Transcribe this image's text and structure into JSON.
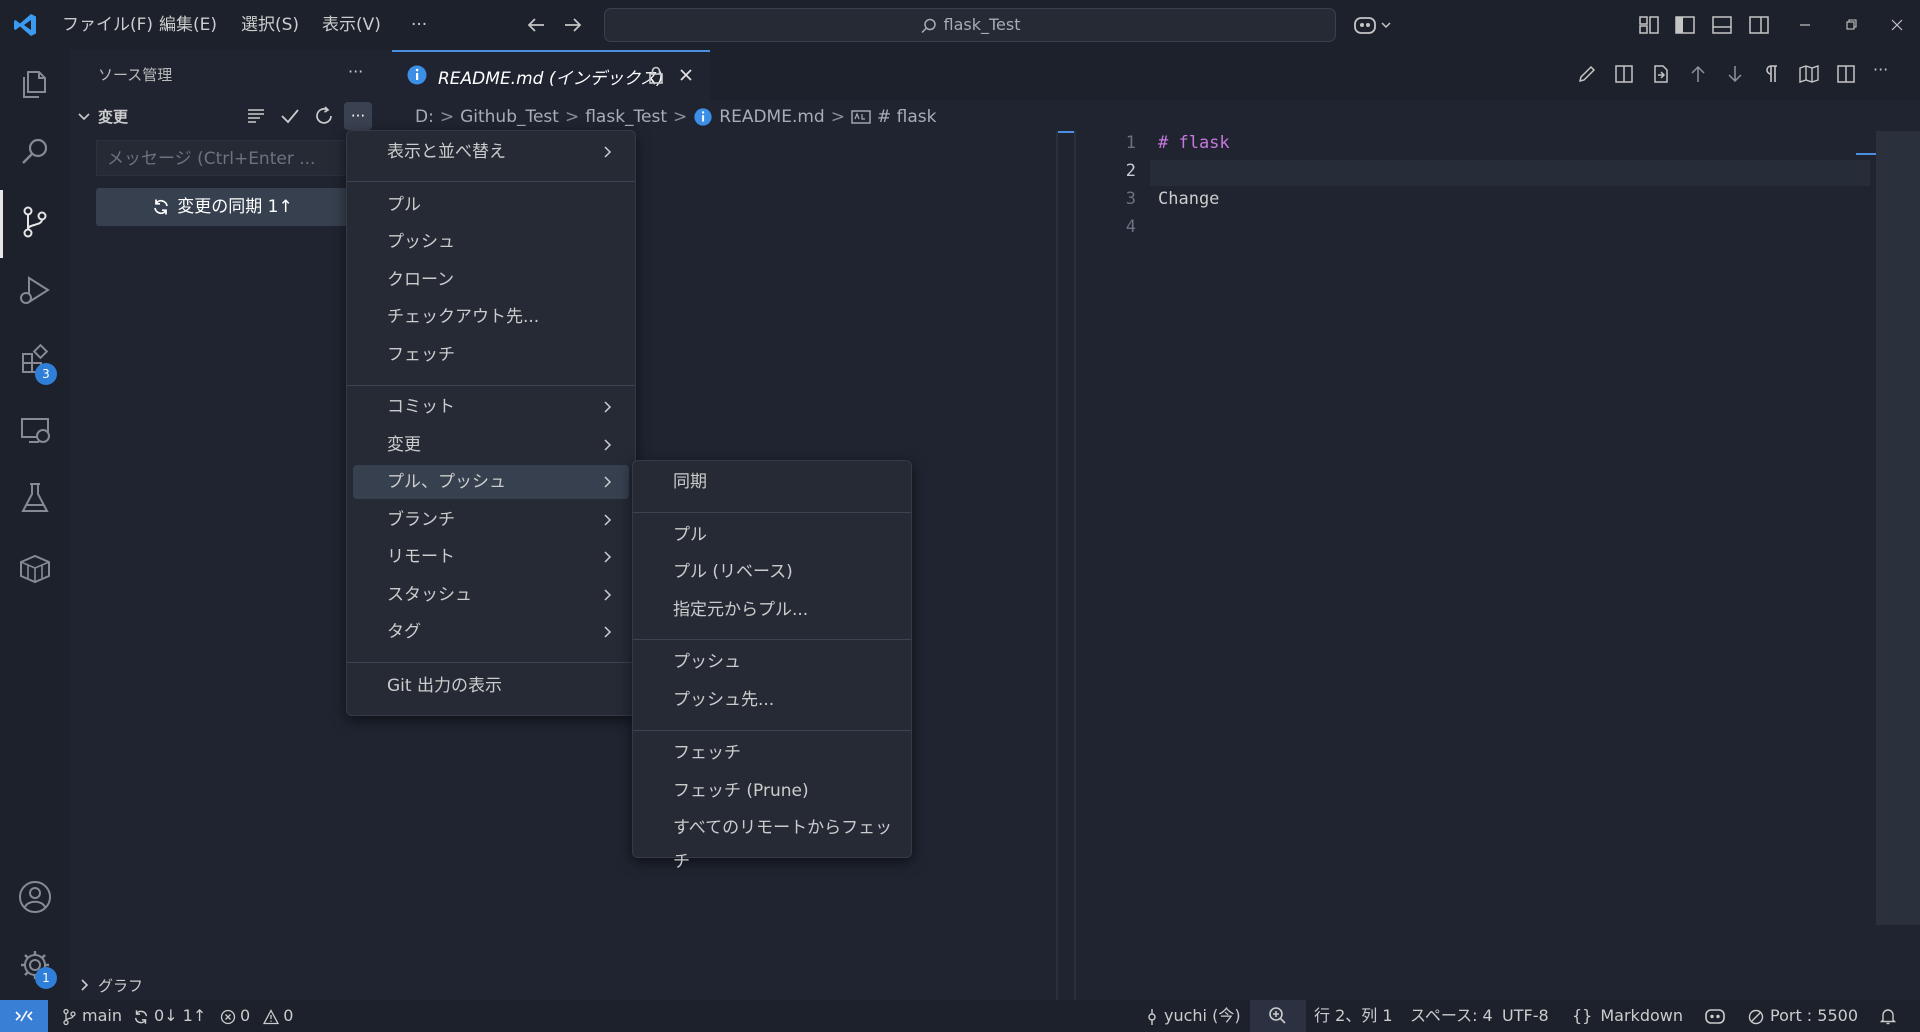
{
  "titlebar": {
    "menus": [
      "ファイル(F)",
      "編集(E)",
      "選択(S)",
      "表示(V)",
      "···"
    ],
    "search_text": "flask_Test"
  },
  "activity": {
    "extensions_badge": "3",
    "settings_badge": "1"
  },
  "sidebar": {
    "title": "ソース管理",
    "more": "···",
    "changes_header": "変更",
    "commit_placeholder": "メッセージ (Ctrl+Enter ...",
    "sync_button": "変更の同期 1↑",
    "graph_header": "グラフ"
  },
  "editor": {
    "tab_label": "README.md (インデックス)",
    "breadcrumb": [
      "D:",
      "Github_Test",
      "flask_Test",
      "README.md",
      "# flask"
    ],
    "lines": [
      {
        "no": "1",
        "text": "# flask"
      },
      {
        "no": "2",
        "text": ""
      },
      {
        "no": "3",
        "text": "Change"
      },
      {
        "no": "4",
        "text": ""
      }
    ]
  },
  "menu": {
    "items": [
      "表示と並べ替え",
      "プル",
      "プッシュ",
      "クローン",
      "チェックアウト先...",
      "フェッチ",
      "コミット",
      "変更",
      "プル、プッシュ",
      "ブランチ",
      "リモート",
      "スタッシュ",
      "タグ",
      "Git 出力の表示"
    ]
  },
  "submenu": {
    "items": [
      "同期",
      "プル",
      "プル (リベース)",
      "指定元からプル...",
      "プッシュ",
      "プッシュ先...",
      "フェッチ",
      "フェッチ (Prune)",
      "すべてのリモートからフェッチ"
    ]
  },
  "statusbar": {
    "branch": "main",
    "sync": "0↓ 1↑",
    "errors": "0",
    "warnings": "0",
    "author": "yuchi (今)",
    "position": "行 2、列 1",
    "spaces": "スペース: 4",
    "encoding": "UTF-8",
    "language": "Markdown",
    "port": "Port : 5500"
  },
  "colors": {
    "accent": "#3a7fd6",
    "menu_bg": "#252a35",
    "menu_highlight": "#37404f",
    "keyword": "#c678dd"
  }
}
